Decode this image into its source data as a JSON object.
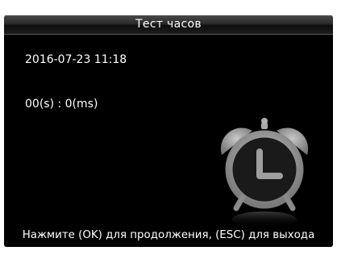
{
  "window": {
    "title": "Тест часов"
  },
  "clock_test": {
    "datetime": "2016-07-23 11:18",
    "elapsed": "00(s) : 0(ms)"
  },
  "footer": {
    "hint": "Нажмите (OK) для продолжения, (ESC) для выхода"
  },
  "icons": {
    "illustration": "alarm-clock-icon"
  },
  "colors": {
    "background": "#000000",
    "text": "#ffffff",
    "icon": "#9a9a9a"
  }
}
